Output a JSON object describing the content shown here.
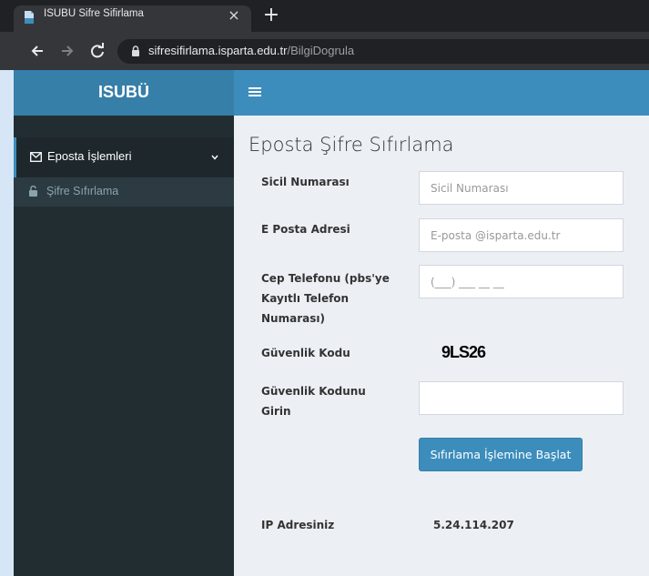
{
  "browser": {
    "tab_title": "ISUBU Sifre Sifirlama",
    "tab_close": "×",
    "new_tab": "+",
    "url_host": "sifresifirlama.isparta.edu.tr",
    "url_path": "/BilgiDogrula"
  },
  "header": {
    "brand": "ISUBÜ",
    "hamburger_icon": "menu-icon"
  },
  "sidebar": {
    "menu_header": {
      "label": "Eposta İşlemleri",
      "icon": "envelope-icon"
    },
    "items": [
      {
        "label": "Şifre Sıfırlama",
        "icon": "unlock-icon"
      }
    ]
  },
  "main": {
    "title": "Eposta Şifre Sıfırlama",
    "fields": {
      "sicil": {
        "label": "Sicil Numarası",
        "placeholder": "Sicil Numarası",
        "value": ""
      },
      "email": {
        "label": "E Posta Adresi",
        "placeholder": "E-posta @isparta.edu.tr",
        "value": ""
      },
      "phone": {
        "label": "Cep Telefonu (pbs'ye Kayıtlı Telefon Numarası)",
        "placeholder": "(___) ___ __ __",
        "value": ""
      },
      "captcha": {
        "label": "Güvenlik Kodu",
        "code": "9LS26"
      },
      "captcha_input": {
        "label": "Güvenlik Kodunu Girin",
        "value": ""
      }
    },
    "submit_label": "Sıfırlama İşlemine Başlat",
    "ip": {
      "label": "IP Adresiniz",
      "value": "5.24.114.207"
    }
  },
  "colors": {
    "accent": "#3c8dbc",
    "accent_dark": "#367fa9",
    "sidebar_bg": "#222d32",
    "content_bg": "#ecf0f5"
  }
}
